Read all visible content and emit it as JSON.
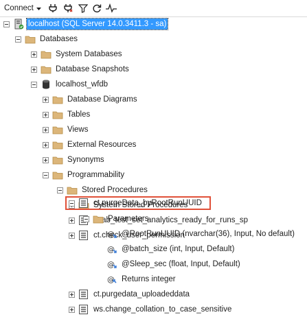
{
  "toolbar": {
    "connect_label": "Connect",
    "icons": [
      "dropdown-icon",
      "connect-object-explorer-icon",
      "disconnect-icon",
      "filter-icon",
      "refresh-icon",
      "activity-monitor-icon"
    ]
  },
  "colors": {
    "selection": "#3399ff",
    "highlight_border": "#e05038",
    "folder": "#dcb67a"
  },
  "tree": {
    "server": "localhost (SQL Server 14.0.3411.3 - sa)",
    "databases": "Databases",
    "system_databases": "System Databases",
    "database_snapshots": "Database Snapshots",
    "db": "localhost_wfdb",
    "database_diagrams": "Database Diagrams",
    "tables": "Tables",
    "views": "Views",
    "external_resources": "External Resources",
    "synonyms": "Synonyms",
    "programmability": "Programmability",
    "stored_procedures": "Stored Procedures",
    "system_stored_procedures": "System Stored Procedures",
    "sp_ab_test": "ct.ab_test_set_analytics_ready_for_runs_sp",
    "sp_check_user": "ct.check_user_permission",
    "sp_purge_root": "ct.purgeData_byRootRunUUID",
    "parameters": "Parameters",
    "param_root": "@RootRunUUID (nvarchar(36), Input, No default)",
    "param_batch": "@batch_size (int, Input, Default)",
    "param_sleep": "@Sleep_sec (float, Input, Default)",
    "returns": "Returns integer",
    "sp_purge_uploaded": "ct.purgedata_uploadeddata",
    "sp_change_collation": "ws.change_collation_to_case_sensitive"
  }
}
